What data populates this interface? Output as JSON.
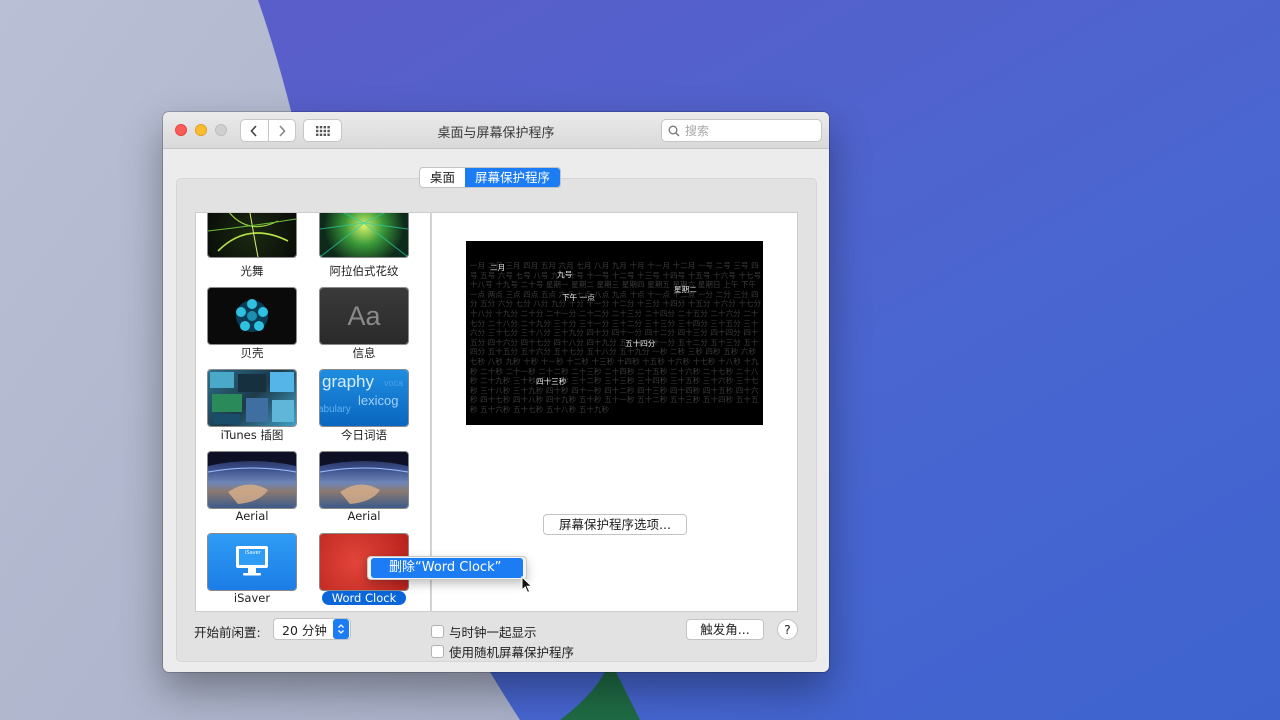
{
  "window": {
    "title": "桌面与屏幕保护程序",
    "search_placeholder": "搜索",
    "nav": {
      "back_icon": "chevron-left-icon",
      "forward_icon": "chevron-right-icon",
      "grid_icon": "grid-icon"
    }
  },
  "tabs": [
    {
      "label": "桌面",
      "active": false
    },
    {
      "label": "屏幕保护程序",
      "active": true
    }
  ],
  "screensavers": [
    {
      "label": "光舞",
      "style": "light-dance"
    },
    {
      "label": "阿拉伯式花纹",
      "style": "arabesque"
    },
    {
      "label": "贝壳",
      "style": "shell"
    },
    {
      "label": "信息",
      "style": "message",
      "tile_text": "Aa"
    },
    {
      "label": "iTunes 插图",
      "style": "itunes"
    },
    {
      "label": "今日词语",
      "style": "word-of-day",
      "tile_text": [
        "graphy",
        "lexicog",
        "abulary",
        "voca"
      ]
    },
    {
      "label": "Aerial",
      "style": "aerial"
    },
    {
      "label": "Aerial",
      "style": "aerial"
    },
    {
      "label": "iSaver",
      "style": "isaver",
      "tile_text": "iSaver"
    },
    {
      "label": "Word Clock",
      "style": "word-clock",
      "selected": true
    }
  ],
  "preview": {
    "highlighted_words": [
      "二月",
      "九号",
      "星期二",
      "下午 一点",
      "五十四分",
      "四十三秒"
    ],
    "background_text": "一月 二月 三月 四月 五月 六月 七月 八月 九月 十月 十一月 十二月 一号 二号 三号 四号 五号 六号 七号 八号 九号 十号 十一号 十二号 十三号 十四号 十五号 十六号 十七号 十八号 十九号 二十号 星期一 星期二 星期三 星期四 星期五 星期六 星期日 上午 下午 一点 两点 三点 四点 五点 六点 七点 八点 九点 十点 十一点 十二点 一分 二分 三分 四分 五分 六分 七分 八分 九分 十分 十一分 十二分 十三分 十四分 十五分 十六分 十七分 十八分 十九分 二十分 二十一分 二十二分 二十三分 二十四分 二十五分 二十六分 二十七分 二十八分 二十九分 三十分 三十一分 三十二分 三十三分 三十四分 三十五分 三十六分 三十七分 三十八分 三十九分 四十分 四十一分 四十二分 四十三分 四十四分 四十五分 四十六分 四十七分 四十八分 四十九分 五十分 五十一分 五十二分 五十三分 五十四分 五十五分 五十六分 五十七分 五十八分 五十九分 一秒 二秒 三秒 四秒 五秒 六秒 七秒 八秒 九秒 十秒 十一秒 十二秒 十三秒 十四秒 十五秒 十六秒 十七秒 十八秒 十九秒 二十秒 二十一秒 二十二秒 二十三秒 二十四秒 二十五秒 二十六秒 二十七秒 二十八秒 二十九秒 三十秒 三十一秒 三十二秒 三十三秒 三十四秒 三十五秒 三十六秒 三十七秒 三十八秒 三十九秒 四十秒 四十一秒 四十二秒 四十三秒 四十四秒 四十五秒 四十六秒 四十七秒 四十八秒 四十九秒 五十秒 五十一秒 五十二秒 五十三秒 五十四秒 五十五秒 五十六秒 五十七秒 五十八秒 五十九秒"
  },
  "options_button": "屏幕保护程序选项...",
  "context_menu": {
    "item": "删除“Word Clock”"
  },
  "bottom": {
    "idle_label": "开始前闲置:",
    "idle_value": "20 分钟",
    "show_clock": "与时钟一起显示",
    "random_saver": "使用随机屏幕保护程序",
    "hot_corners": "触发角...",
    "help": "?"
  },
  "colors": {
    "accent": "#1c7cf3",
    "selected_label": "#0a66d9"
  }
}
